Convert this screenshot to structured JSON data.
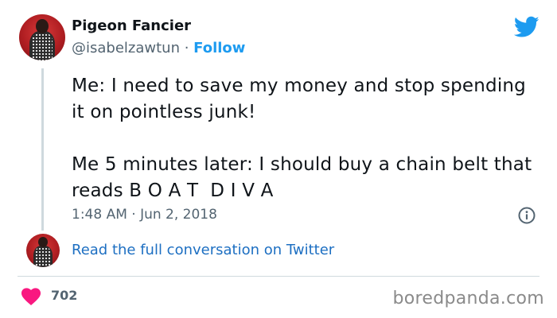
{
  "author": {
    "display_name": "Pigeon Fancier",
    "handle": "@isabelzawtun",
    "separator": " · ",
    "follow_label": "Follow"
  },
  "tweet": {
    "paragraphs": [
      "Me: I need to save my money and stop spending it on pointless junk!",
      "Me 5 minutes later: I should buy a chain belt that reads B O A T  D I V A"
    ],
    "timestamp": "1:48 AM · Jun 2, 2018"
  },
  "conversation": {
    "read_full_label": "Read the full conversation on Twitter"
  },
  "footer": {
    "like_count": "702",
    "watermark": "boredpanda.com"
  },
  "icons": {
    "brand": "twitter-bird-icon",
    "info": "info-icon",
    "like": "heart-icon"
  },
  "colors": {
    "twitter_blue": "#1d9bf0",
    "link_blue": "#1d6fc2",
    "heart": "#f91880",
    "muted_text": "#536471",
    "thread_line": "#cfd9de"
  }
}
